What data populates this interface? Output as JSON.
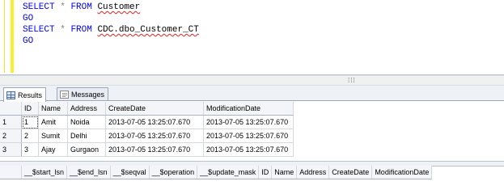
{
  "editor": {
    "lines": [
      {
        "kw1": "SELECT",
        "op": "*",
        "kw2": "FROM",
        "table": "Customer"
      },
      {
        "go": "GO"
      },
      {
        "kw1": "SELECT",
        "op": "*",
        "kw2": "FROM",
        "table": "CDC.dbo_Customer_CT"
      },
      {
        "go": "GO"
      }
    ]
  },
  "scrollbar": {
    "grip": "⁞⁞⁞"
  },
  "tabs": {
    "results": "Results",
    "messages": "Messages"
  },
  "results_grid": {
    "columns": [
      "ID",
      "Name",
      "Address",
      "CreateDate",
      "ModificationDate"
    ],
    "rows": [
      {
        "rownum": "1",
        "cells": [
          "1",
          "Amit",
          "Noida",
          "2013-07-05 13:25:07.670",
          "2013-07-05 13:25:07.670"
        ]
      },
      {
        "rownum": "2",
        "cells": [
          "2",
          "Sumit",
          "Delhi",
          "2013-07-05 13:25:07.670",
          "2013-07-05 13:25:07.670"
        ]
      },
      {
        "rownum": "3",
        "cells": [
          "3",
          "Ajay",
          "Gurgaon",
          "2013-07-05 13:25:07.670",
          "2013-07-05 13:25:07.670"
        ]
      }
    ]
  },
  "ct_grid": {
    "columns": [
      "__$start_lsn",
      "__$end_lsn",
      "__$seqval",
      "__$operation",
      "__$update_mask",
      "ID",
      "Name",
      "Address",
      "CreateDate",
      "ModificationDate"
    ]
  }
}
